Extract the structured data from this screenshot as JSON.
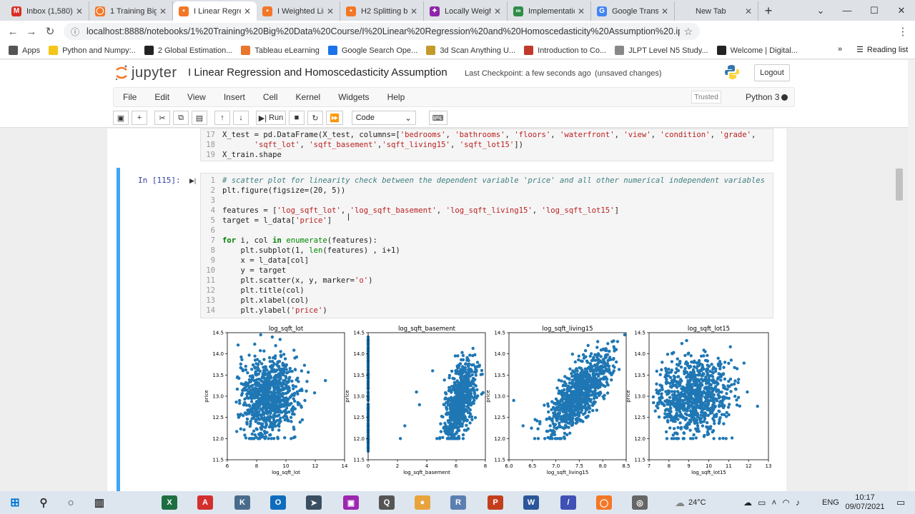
{
  "browser": {
    "tabs": [
      {
        "label": "Inbox (1,580)",
        "icon": "gmail-icon",
        "color": "#d93025",
        "glyph": "M"
      },
      {
        "label": "1 Training Big",
        "icon": "jupyter-icon",
        "color": "#f37726",
        "glyph": "◯"
      },
      {
        "label": "I Linear Regre",
        "icon": "notebook-icon",
        "color": "#f37726",
        "glyph": "▪",
        "active": true
      },
      {
        "label": "I Weighted Lin",
        "icon": "notebook-icon",
        "color": "#f37726",
        "glyph": "▪"
      },
      {
        "label": "H2 Splitting b",
        "icon": "notebook-icon",
        "color": "#f37726",
        "glyph": "▪"
      },
      {
        "label": "Locally Weight",
        "icon": "bookmark-icon",
        "color": "#8e24aa",
        "glyph": "✦"
      },
      {
        "label": "Implementatio",
        "icon": "geeks-icon",
        "color": "#2f8d46",
        "glyph": "∞"
      },
      {
        "label": "Google Transla",
        "icon": "translate-icon",
        "color": "#4285f4",
        "glyph": "G"
      },
      {
        "label": "New Tab",
        "icon": "newtab-icon",
        "color": "#dee1e6",
        "glyph": ""
      }
    ],
    "url": "localhost:8888/notebooks/1%20Training%20Big%20Data%20Course/I%20Linear%20Regression%20and%20Homoscedasticity%20Assumption%20.ipynb",
    "bookmarks": [
      {
        "label": "Apps",
        "color": "#555"
      },
      {
        "label": "Python and Numpy:..",
        "color": "#f5c518"
      },
      {
        "label": "2 Global Estimation...",
        "color": "#222"
      },
      {
        "label": "Tableau eLearning",
        "color": "#e8762d"
      },
      {
        "label": "Google Search Ope...",
        "color": "#1a73e8"
      },
      {
        "label": "3d Scan Anything U...",
        "color": "#c49a2a"
      },
      {
        "label": "Introduction to Co...",
        "color": "#c0392b"
      },
      {
        "label": "JLPT Level N5 Study...",
        "color": "#888"
      },
      {
        "label": "Welcome | Digital...",
        "color": "#222"
      }
    ],
    "reading_list": "Reading list",
    "more": "»"
  },
  "jupyter": {
    "logo_text": "jupyter",
    "title": "I Linear Regression and Homoscedasticity Assumption",
    "checkpoint": "Last Checkpoint: a few seconds ago",
    "unsaved": "(unsaved changes)",
    "logout": "Logout",
    "menu": [
      "File",
      "Edit",
      "View",
      "Insert",
      "Cell",
      "Kernel",
      "Widgets",
      "Help"
    ],
    "trusted": "Trusted",
    "kernel": "Python 3",
    "run_label": "Run",
    "cell_type": "Code"
  },
  "cells": {
    "prev_lines": [
      {
        "n": "17",
        "t": "X_test = pd.DataFrame(X_test, columns=['bedrooms', 'bathrooms', 'floors', 'waterfront', 'view', 'condition', 'grade',"
      },
      {
        "n": "18",
        "t": "       'sqft_lot', 'sqft_basement','sqft_living15', 'sqft_lot15'])"
      },
      {
        "n": "19",
        "t": "X_train.shape"
      }
    ],
    "prompt": "In [115]:",
    "lines": [
      {
        "n": "1",
        "t": "# scatter plot for linearity check between the dependent variable 'price' and all other numerical independent variables"
      },
      {
        "n": "2",
        "t": "plt.figure(figsize=(20, 5))"
      },
      {
        "n": "3",
        "t": ""
      },
      {
        "n": "4",
        "t": "features = ['log_sqft_lot', 'log_sqft_basement', 'log_sqft_living15', 'log_sqft_lot15']"
      },
      {
        "n": "5",
        "t": "target = l_data['price']"
      },
      {
        "n": "6",
        "t": ""
      },
      {
        "n": "7",
        "t": "for i, col in enumerate(features):"
      },
      {
        "n": "8",
        "t": "    plt.subplot(1, len(features) , i+1)"
      },
      {
        "n": "9",
        "t": "    x = l_data[col]"
      },
      {
        "n": "10",
        "t": "    y = target"
      },
      {
        "n": "11",
        "t": "    plt.scatter(x, y, marker='o')"
      },
      {
        "n": "12",
        "t": "    plt.title(col)"
      },
      {
        "n": "13",
        "t": "    plt.xlabel(col)"
      },
      {
        "n": "14",
        "t": "    plt.ylabel('price')"
      }
    ]
  },
  "chart_data": [
    {
      "type": "scatter",
      "title": "log_sqft_lot",
      "xlabel": "log_sqft_lot",
      "ylabel": "price",
      "xlim": [
        6,
        14
      ],
      "ylim": [
        11.5,
        14.5
      ],
      "xticks": [
        6,
        8,
        10,
        12,
        14
      ],
      "yticks": [
        11.5,
        12.0,
        12.5,
        13.0,
        13.5,
        14.0,
        14.5
      ],
      "color": "#1f77b4"
    },
    {
      "type": "scatter",
      "title": "log_sqft_basement",
      "xlabel": "log_sqft_basement",
      "ylabel": "price",
      "xlim": [
        0,
        8
      ],
      "ylim": [
        11.5,
        14.5
      ],
      "xticks": [
        0,
        2,
        4,
        6,
        8
      ],
      "yticks": [
        11.5,
        12.0,
        12.5,
        13.0,
        13.5,
        14.0,
        14.5
      ],
      "color": "#1f77b4"
    },
    {
      "type": "scatter",
      "title": "log_sqft_living15",
      "xlabel": "log_sqft_living15",
      "ylabel": "price",
      "xlim": [
        6.0,
        8.5
      ],
      "ylim": [
        11.5,
        14.5
      ],
      "xticks": [
        6.0,
        6.5,
        7.0,
        7.5,
        8.0,
        8.5
      ],
      "yticks": [
        11.5,
        12.0,
        12.5,
        13.0,
        13.5,
        14.0,
        14.5
      ],
      "color": "#1f77b4"
    },
    {
      "type": "scatter",
      "title": "log_sqft_lot15",
      "xlabel": "log_sqft_lot15",
      "ylabel": "price",
      "xlim": [
        7,
        13
      ],
      "ylim": [
        11.5,
        14.5
      ],
      "xticks": [
        7,
        8,
        9,
        10,
        11,
        12,
        13
      ],
      "yticks": [
        11.5,
        12.0,
        12.5,
        13.0,
        13.5,
        14.0,
        14.5
      ],
      "color": "#1f77b4"
    }
  ],
  "taskbar": {
    "apps": [
      {
        "name": "search-icon",
        "color": "#333",
        "glyph": "⚲"
      },
      {
        "name": "cortana-icon",
        "color": "#333",
        "glyph": "○"
      },
      {
        "name": "task-view-icon",
        "color": "#333",
        "glyph": "▥"
      },
      {
        "name": "excel-icon",
        "color": "#1d6f42",
        "glyph": "X"
      },
      {
        "name": "acrobat-icon",
        "color": "#d32f2f",
        "glyph": "A"
      },
      {
        "name": "app-k-icon",
        "color": "#4a6c8c",
        "glyph": "K"
      },
      {
        "name": "outlook-icon",
        "color": "#0f6cbd",
        "glyph": "O"
      },
      {
        "name": "app-arrow-icon",
        "color": "#3b4f63",
        "glyph": "➤"
      },
      {
        "name": "app-purple-icon",
        "color": "#9c27b0",
        "glyph": "▣"
      },
      {
        "name": "app-q-icon",
        "color": "#555",
        "glyph": "Q"
      },
      {
        "name": "chrome-icon",
        "color": "#e8a33d",
        "glyph": "●"
      },
      {
        "name": "r-icon",
        "color": "#5a7fb0",
        "glyph": "R"
      },
      {
        "name": "powerpoint-icon",
        "color": "#c43e1c",
        "glyph": "P"
      },
      {
        "name": "word-icon",
        "color": "#2b579a",
        "glyph": "W"
      },
      {
        "name": "app-pen-icon",
        "color": "#3f51b5",
        "glyph": "/"
      },
      {
        "name": "jupyter-taskbar-icon",
        "color": "#f37726",
        "glyph": "◯"
      },
      {
        "name": "app-globe-icon",
        "color": "#666",
        "glyph": "◎"
      }
    ],
    "temperature": "24°C",
    "language": "ENG",
    "time": "10:17",
    "date": "09/07/2021"
  }
}
